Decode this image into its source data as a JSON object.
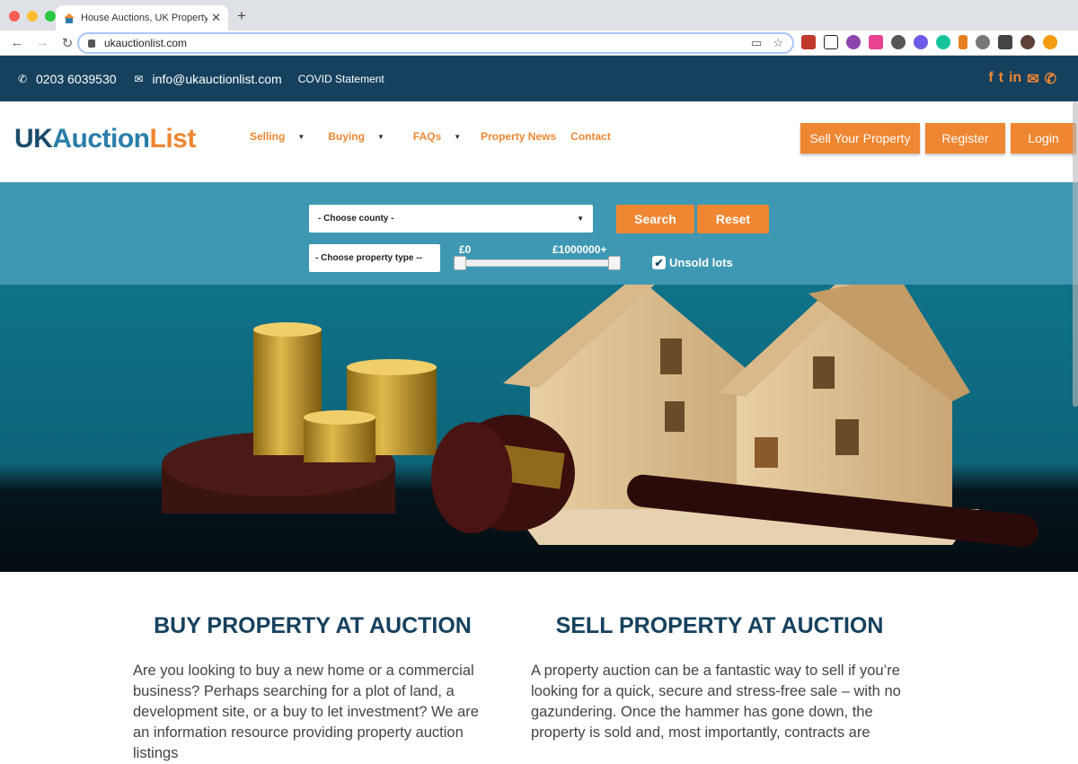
{
  "browser": {
    "tab_title": "House Auctions, UK Property A",
    "url": "ukauctionlist.com",
    "traffic_colors": [
      "#ff5f57",
      "#febc2e",
      "#28c840"
    ]
  },
  "topbar": {
    "phone": "0203 6039530",
    "email": "info@ukauctionlist.com",
    "covid": "COVID Statement",
    "social_icons": [
      "facebook-icon",
      "twitter-icon",
      "linkedin-icon",
      "mail-icon",
      "phone-icon"
    ],
    "social_glyphs": "f ✓ in ✉ ✆"
  },
  "header": {
    "logo_uk": "UK",
    "logo_auction": "Auction",
    "logo_list": "List",
    "nav": [
      {
        "label": "Selling",
        "dropdown": true
      },
      {
        "label": "Buying",
        "dropdown": true
      },
      {
        "label": "FAQs",
        "dropdown": true
      },
      {
        "label": "Property News",
        "dropdown": false
      },
      {
        "label": "Contact",
        "dropdown": false
      }
    ],
    "buttons": {
      "sell": "Sell Your Property",
      "register": "Register",
      "login": "Login"
    }
  },
  "search": {
    "county": "- Choose county -",
    "property_type": "- Choose property type --",
    "search_label": "Search",
    "reset_label": "Reset",
    "price_min": "£0",
    "price_max": "£1000000+",
    "unsold_label": "Unsold lots",
    "unsold_checked": true,
    "range_fraction": [
      0,
      1
    ]
  },
  "content": {
    "buy": {
      "heading": "BUY PROPERTY AT AUCTION",
      "text": "Are you looking to buy a new home or a commercial business? Perhaps searching for a plot of land, a development site, or a buy to let investment? We are an information resource providing property auction listings"
    },
    "sell": {
      "heading": "SELL PROPERTY AT AUCTION",
      "text": "A property auction can be a fantastic way to sell if you’re looking for a quick, secure and stress-free sale – with no gazundering. Once the hammer has gone down, the property is sold and, most importantly, contracts are"
    }
  },
  "colors": {
    "navy": "#16415e",
    "orange": "#ef8631",
    "teal": "#3f98b3"
  }
}
